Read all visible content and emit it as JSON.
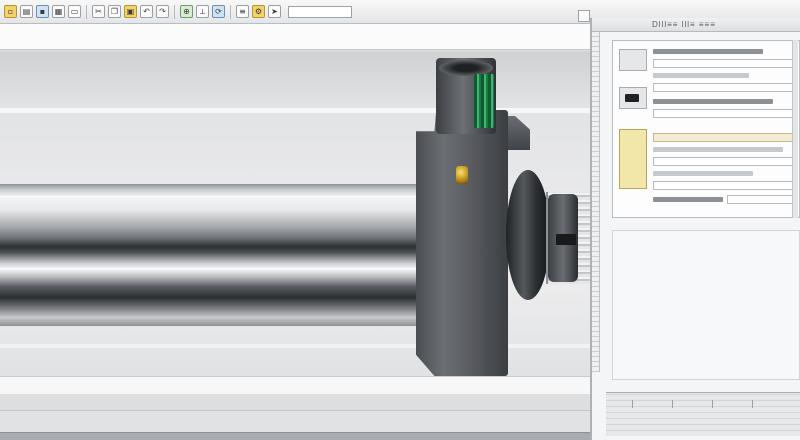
{
  "toolbar": {
    "buttons": [
      {
        "icon": "new-file-icon",
        "glyph": "▫",
        "tone": "accent"
      },
      {
        "icon": "open-folder-icon",
        "glyph": "▤",
        "tone": ""
      },
      {
        "icon": "save-icon",
        "glyph": "▪",
        "tone": "blue"
      },
      {
        "icon": "grid-icon",
        "glyph": "▦",
        "tone": ""
      },
      {
        "icon": "print-icon",
        "glyph": "▭",
        "tone": ""
      },
      {
        "icon": "cut-icon",
        "glyph": "✂",
        "tone": ""
      },
      {
        "icon": "copy-icon",
        "glyph": "❐",
        "tone": ""
      },
      {
        "icon": "paste-icon",
        "glyph": "▣",
        "tone": "accent"
      },
      {
        "icon": "undo-icon",
        "glyph": "↶",
        "tone": ""
      },
      {
        "icon": "redo-icon",
        "glyph": "↷",
        "tone": ""
      },
      {
        "icon": "zoom-icon",
        "glyph": "⊕",
        "tone": "green"
      },
      {
        "icon": "measure-icon",
        "glyph": "⟂",
        "tone": ""
      },
      {
        "icon": "rotate-icon",
        "glyph": "⟳",
        "tone": "blue"
      },
      {
        "icon": "layer-icon",
        "glyph": "≡",
        "tone": ""
      },
      {
        "icon": "settings-icon",
        "glyph": "⚙",
        "tone": "accent"
      },
      {
        "icon": "pointer-icon",
        "glyph": "➤",
        "tone": ""
      }
    ]
  },
  "panel": {
    "header_text": "Dlll≡≡  lll≡  ≡≡≡",
    "thumbnails": [
      {
        "icon": "part-preview-icon",
        "tone": ""
      },
      {
        "icon": "tool-preview-icon",
        "tone": "dark"
      },
      {
        "icon": "note-preview-icon",
        "tone": "yellow"
      }
    ]
  },
  "colors": {
    "grip_green": "#3fb56d",
    "pin_gold": "#d9b43a",
    "panel_bg": "#f4f5f6",
    "toolbar_bg": "#e4e5e7"
  }
}
